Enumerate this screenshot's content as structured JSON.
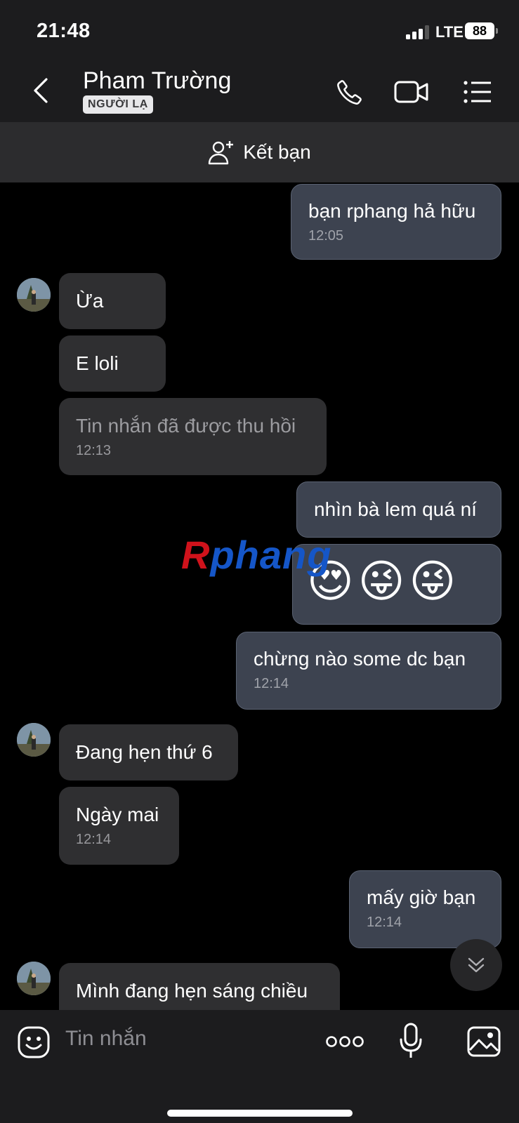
{
  "status_bar": {
    "time": "21:48",
    "network": "LTE",
    "battery": "88"
  },
  "header": {
    "contact_name": "Pham Trường",
    "badge": "NGƯỜI LẠ"
  },
  "add_friend": {
    "label": "Kết bạn"
  },
  "watermark": {
    "r": "R",
    "rest": "phang"
  },
  "messages": [
    {
      "dir": "out",
      "text": "bạn rphang hả hữu",
      "time": "12:05"
    },
    {
      "dir": "in",
      "text": "Ừa",
      "time": ""
    },
    {
      "dir": "in",
      "text": "E loli",
      "time": ""
    },
    {
      "dir": "in",
      "text": "Tin nhắn đã được thu hồi",
      "time": "12:13",
      "recalled": true
    },
    {
      "dir": "out",
      "text": "nhìn bà lem quá ní",
      "time": ""
    },
    {
      "dir": "out",
      "text": "😍😜😜",
      "time": "",
      "emoji": true
    },
    {
      "dir": "out",
      "text": "chừng nào some dc bạn",
      "time": "12:14"
    },
    {
      "dir": "in",
      "text": "Đang hẹn thứ 6",
      "time": ""
    },
    {
      "dir": "in",
      "text": "Ngày mai",
      "time": "12:14"
    },
    {
      "dir": "out",
      "text": "mấy giờ bạn",
      "time": "12:14"
    },
    {
      "dir": "in",
      "text": "Mình đang hẹn sáng chiều",
      "time": ""
    }
  ],
  "input": {
    "placeholder": "Tin nhắn"
  },
  "icons": {
    "back": "chevron-left-icon",
    "call": "phone-icon",
    "video": "video-camera-icon",
    "menu": "list-menu-icon",
    "add_friend": "add-user-icon",
    "sticker": "sticker-smile-icon",
    "more": "more-dots-icon",
    "mic": "microphone-icon",
    "image": "image-icon",
    "scroll": "double-chevron-down-icon"
  }
}
